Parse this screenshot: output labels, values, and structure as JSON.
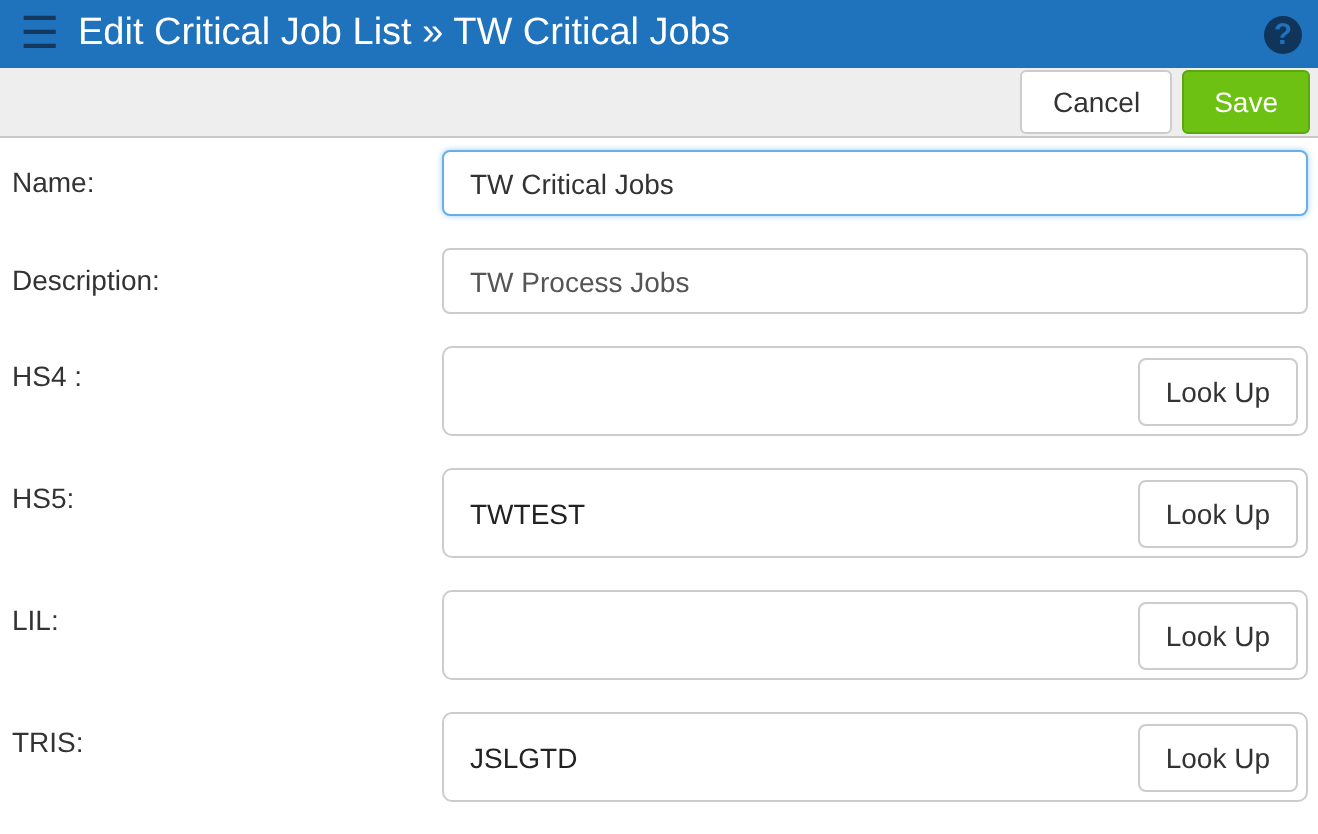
{
  "header": {
    "menu_icon": "☰",
    "title": "Edit Critical Job List » TW Critical Jobs",
    "help_icon": "?"
  },
  "toolbar": {
    "buttons": [
      {
        "label": "Cancel",
        "kind": "secondary"
      },
      {
        "label": "Save",
        "kind": "primary"
      }
    ]
  },
  "fields": [
    {
      "label": "Name:",
      "kind": "text",
      "value": "TW Critical Jobs",
      "focused": true
    },
    {
      "label": "Description:",
      "kind": "text",
      "value": "TW Process Jobs",
      "focused": false
    },
    {
      "label": "HS4 :",
      "kind": "lookup",
      "button": "Look Up"
    },
    {
      "label": "HS5:",
      "kind": "lookup",
      "value": "TWTEST",
      "button": "Look Up"
    },
    {
      "label": "LIL:",
      "kind": "lookup",
      "button": "Look Up"
    },
    {
      "label": "TRIS:",
      "kind": "lookup",
      "value": "JSLGTD",
      "button": "Look Up"
    }
  ]
}
